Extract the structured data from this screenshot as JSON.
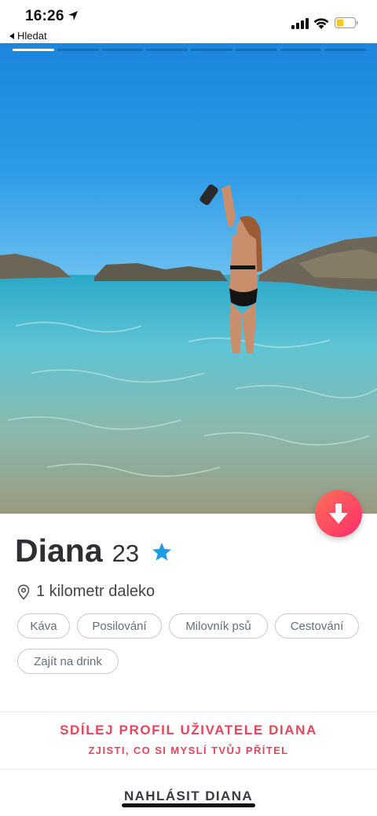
{
  "status_bar": {
    "time": "16:26",
    "back_label": "Hledat",
    "icons": [
      "location-arrow-icon",
      "signal-icon",
      "wifi-icon",
      "battery-icon"
    ],
    "battery_color": "#f7c924"
  },
  "photo": {
    "page_count": 8,
    "active_page": 1,
    "description_colors": {
      "sky": "#1e8fe0",
      "sea": "#5ec4d4"
    }
  },
  "profile": {
    "name": "Diana",
    "age": "23",
    "distance": "1 kilometr daleko",
    "interests": [
      "Káva",
      "Posilování",
      "Milovník psů",
      "Cestování",
      "Zajít na drink"
    ]
  },
  "share": {
    "title": "SDÍLEJ PROFIL UŽIVATELE DIANA",
    "subtitle": "ZJISTI, CO SI MYSLÍ TVŮJ PŘÍTEL"
  },
  "report_label": "NAHLÁSIT DIANA",
  "colors": {
    "accent": "#e6455a",
    "button_gradient_start": "#ff6f57",
    "button_gradient_end": "#fd2d6b",
    "verified_star": "#1e9be6"
  }
}
